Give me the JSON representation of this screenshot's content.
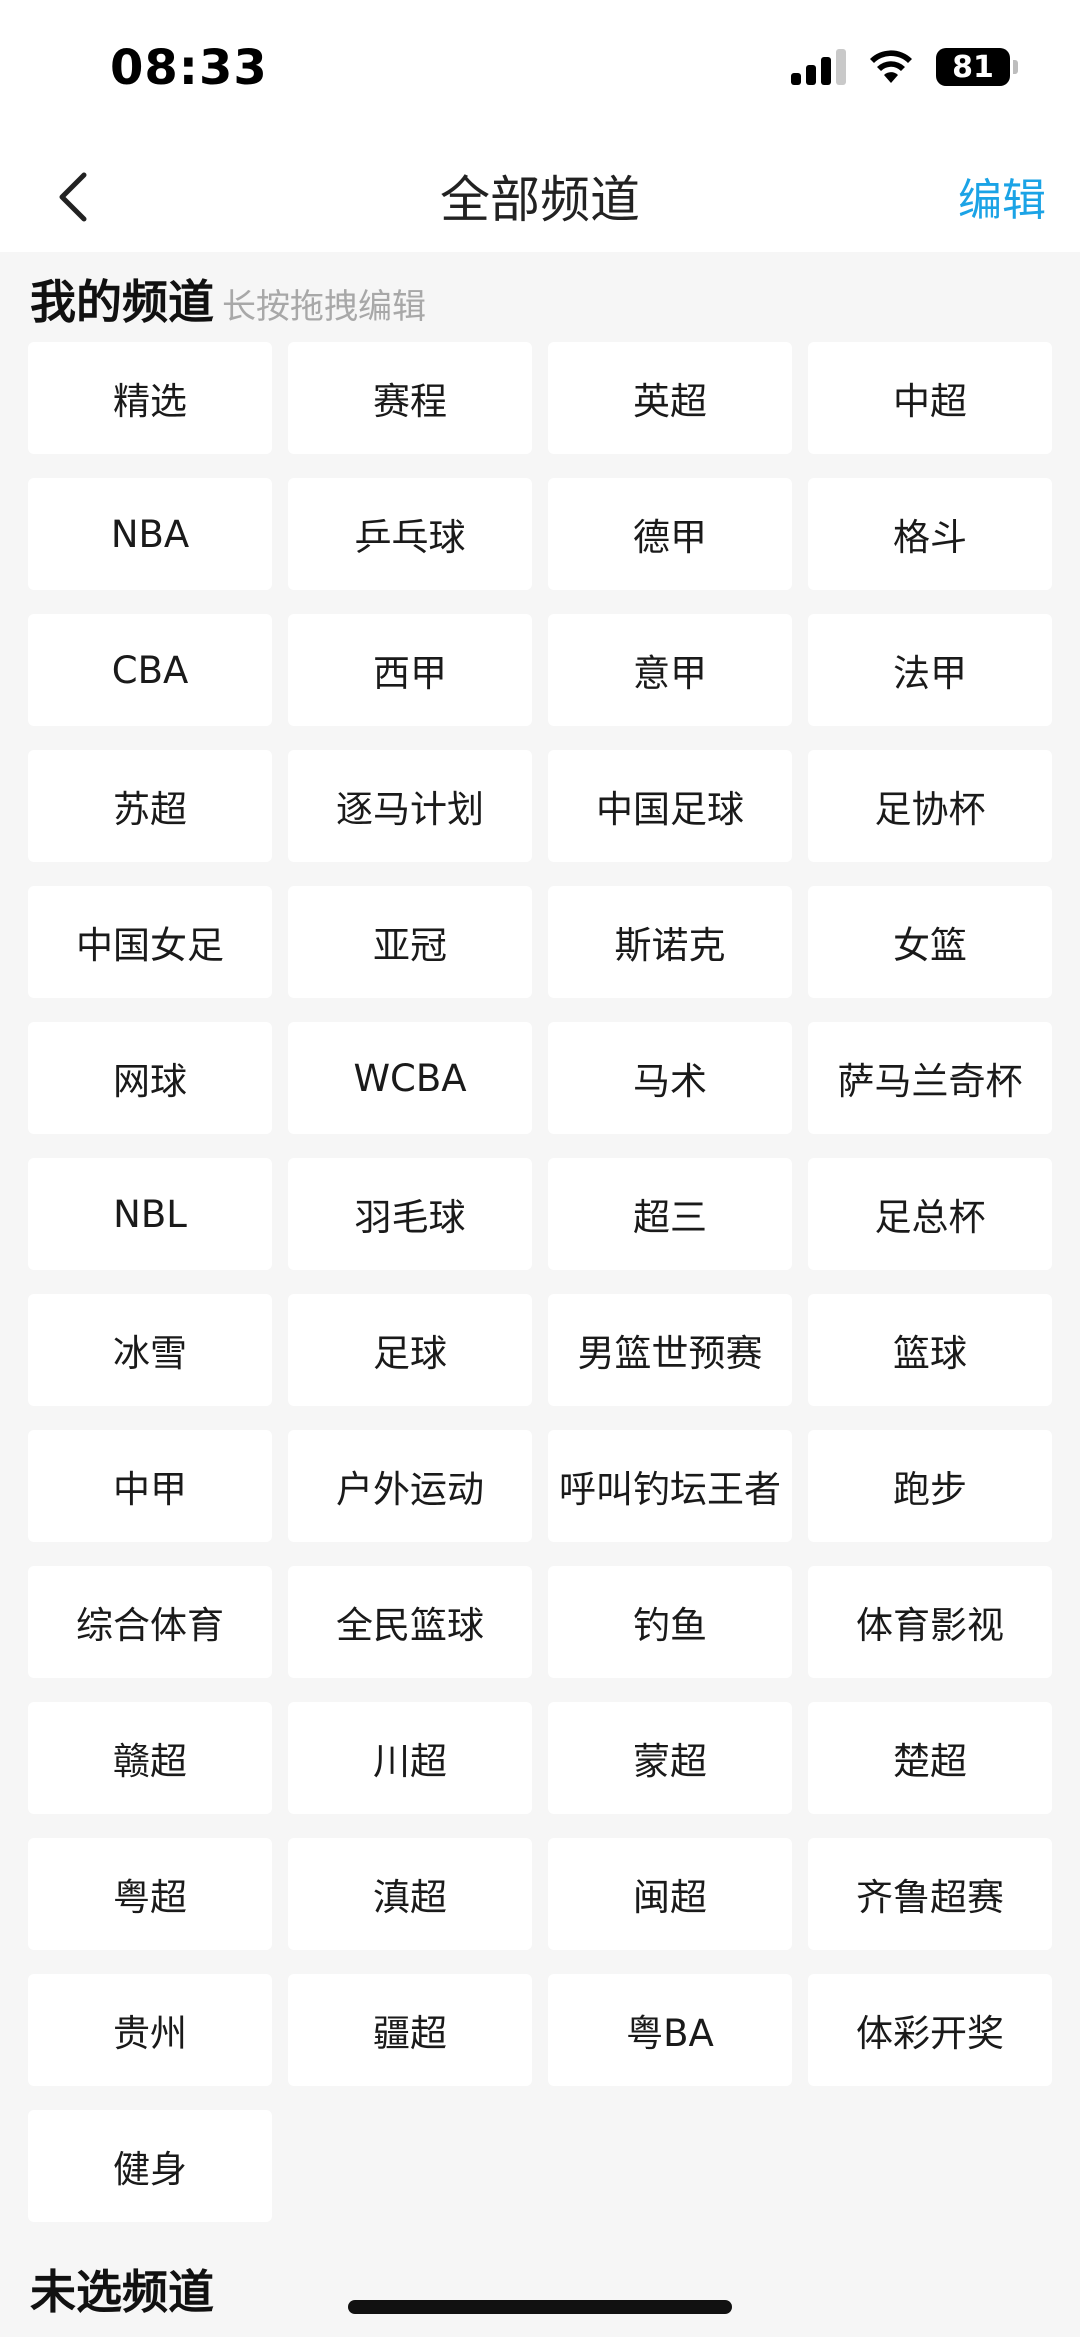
{
  "status_bar": {
    "time": "08:33",
    "battery": "81"
  },
  "nav": {
    "title": "全部频道",
    "edit_label": "编辑"
  },
  "my_channels": {
    "title": "我的频道",
    "hint": "长按拖拽编辑",
    "items": [
      "精选",
      "赛程",
      "英超",
      "中超",
      "NBA",
      "乒乓球",
      "德甲",
      "格斗",
      "CBA",
      "西甲",
      "意甲",
      "法甲",
      "苏超",
      "逐马计划",
      "中国足球",
      "足协杯",
      "中国女足",
      "亚冠",
      "斯诺克",
      "女篮",
      "网球",
      "WCBA",
      "马术",
      "萨马兰奇杯",
      "NBL",
      "羽毛球",
      "超三",
      "足总杯",
      "冰雪",
      "足球",
      "男篮世预赛",
      "篮球",
      "中甲",
      "户外运动",
      "呼叫钓坛王者",
      "跑步",
      "综合体育",
      "全民篮球",
      "钓鱼",
      "体育影视",
      "赣超",
      "川超",
      "蒙超",
      "楚超",
      "粤超",
      "滇超",
      "闽超",
      "齐鲁超赛",
      "贵州",
      "疆超",
      "粤BA",
      "体彩开奖",
      "健身"
    ]
  },
  "unselected_channels": {
    "title": "未选频道"
  }
}
